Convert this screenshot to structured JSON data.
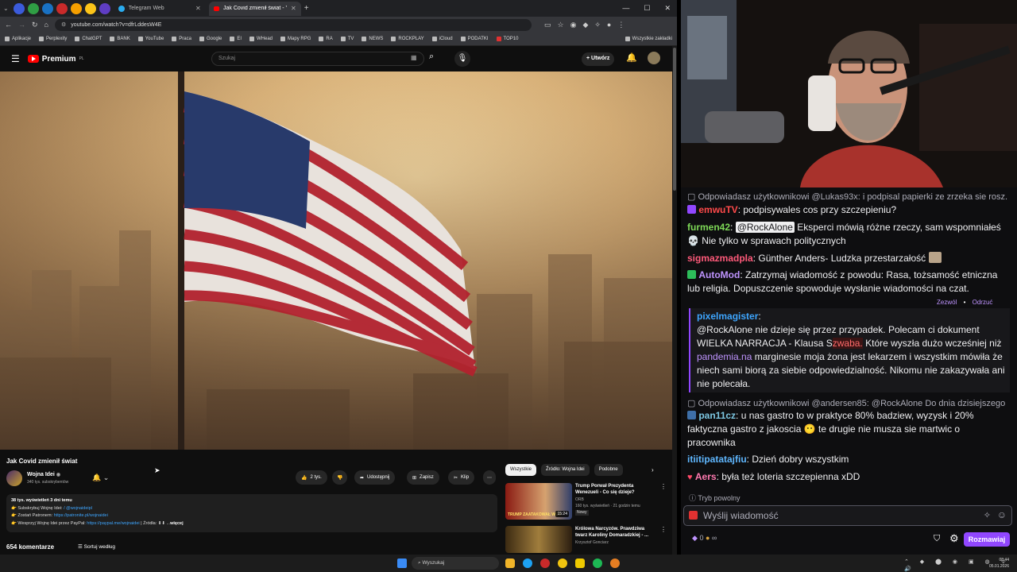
{
  "browser": {
    "tabs": [
      {
        "label": "Telegram Web"
      },
      {
        "label": "Jak Covid zmienił świat - YouT..."
      }
    ],
    "url": "youtube.com/watch?v=dfrLddesW4E",
    "bookmarks": [
      "Aplikacje",
      "Perplexity",
      "ChatGPT",
      "BANK",
      "YouTube",
      "Praca",
      "Google",
      "EI",
      "WHead",
      "Mapy RPG",
      "RA",
      "TV",
      "NEWS",
      "ROCKPLAY",
      "iCloud",
      "PODATKI",
      "TOP10"
    ],
    "all_bookmarks": "Wszystkie zakładki"
  },
  "youtube": {
    "logo": "Premium",
    "logo_sup": "PL",
    "search_placeholder": "Szukaj",
    "create": "Utwórz",
    "title": "Jak Covid zmienił świat",
    "channel": "Wojna Idei",
    "subs": "340 tys. subskrybentów",
    "likes": "2 tys.",
    "share": "Udostępnij",
    "save": "Zapisz",
    "clip": "Klip",
    "desc": {
      "stats": "38 tys. wyświetleń  3 dni temu",
      "line1_pre": "👉 Subskrybuj Wojnę Idei: ",
      "line1_link": "/ @wojnaideipl",
      "line2_pre": "👉 Zostań Patronem: ",
      "line2_link": "https://patronite.pl/wojnaidei",
      "line3_pre": "👉 Wesprzyj Wojnę Idei przez PayPal: ",
      "line3_link": "https://paypal.me/wojnaidei",
      "line3_post": "  |   Źródła: ⬇⬇ ...",
      "more": "więcej"
    },
    "comments": "654 komentarze",
    "sort": "Sortuj według",
    "chips": [
      "Wszystkie",
      "Źródło: Wojna Idei",
      "Podobne"
    ],
    "recs": [
      {
        "title": "Trump Porwał Prezydenta Wenezueli - Co się dzieje?",
        "channel": "ORB",
        "meta": "160 tys. wyświetleń · 21 godzin temu",
        "badge": "Nowy",
        "dur": "15:24",
        "thumb_caption": "TRUMP ZAATAKOWAŁ WEN"
      },
      {
        "title": "Królowa Narcyzów. Prawdziwa twarz Karoliny Domaradzkiej - ...",
        "channel": "Krzysztof Gonciarz",
        "meta": "",
        "badge": "",
        "dur": "",
        "thumb_caption": ""
      }
    ]
  },
  "taskbar": {
    "search": "Wyszukaj",
    "time": "08:44",
    "date": "05.01.2026"
  },
  "chat": {
    "msgs": [
      {
        "type": "reply",
        "text": "Odpowiadasz użytkownikowi @Lukas93x: i podpisal papierki ze zrzeka sie rosz..."
      },
      {
        "user": "emwuTV",
        "color": "#ff4a4a",
        "text": "podpisywales cos przy szczepieniu?"
      },
      {
        "user": "furmen42",
        "color": "#7ed957",
        "mention": "@RockAlone",
        "text": " Eksperci mówią różne rzeczy, sam wspomniałeś 💀 Nie tylko w sprawach politycznych"
      },
      {
        "user": "sigmazmadpla",
        "color": "#ff5a7a",
        "text": "Günther Anders- Ludzka przestarzałość"
      },
      {
        "user": "AutoMod",
        "color": "#bf94ff",
        "text": "Zatrzymaj wiadomość z powodu: Rasa, tożsamość etniczna lub religia. Dopuszczenie spowoduje wysłanie wiadomości na czat."
      }
    ],
    "automod_allow": "Zezwól",
    "automod_deny": "Odrzuć",
    "pixel_user": "pixelmagister",
    "pixel_text1": "@RockAlone nie dzieje się przez przypadek. Polecam ci dokument WIELKA NARRACJA - Klausa S",
    "pixel_flag": "zwaba.",
    "pixel_text2": " Które wyszła dużo wcześniej niż ",
    "pixel_link": "pandemia.na",
    "pixel_text3": " marginesie moja żona jest lekarzem i wszystkim mówiła że niech sami biorą za siebie odpowiedzialność. Nikomu nie zakazywała ani nie polecała.",
    "reply2": "Odpowiadasz użytkownikowi @andersen85: @RockAlone Do dnia dzisiejszego ...",
    "m_pan_user": "pan11cz",
    "m_pan_text": "u nas gastro to w praktyce 80% badziew, wyzysk i 20% faktyczna gastro z jakoscia 😶 te drugie nie musza sie martwic o pracownika",
    "m_it_user": "itiitipatatajfiu",
    "m_it_text": "Dzień dobry wszystkim",
    "m_ae_user": "Aers",
    "m_ae_text": "była też loteria szczepienna xDD",
    "slowmode": "Tryb powolny",
    "input_placeholder": "Wyślij wiadomość",
    "points": "0",
    "send": "Rozmawiaj"
  }
}
